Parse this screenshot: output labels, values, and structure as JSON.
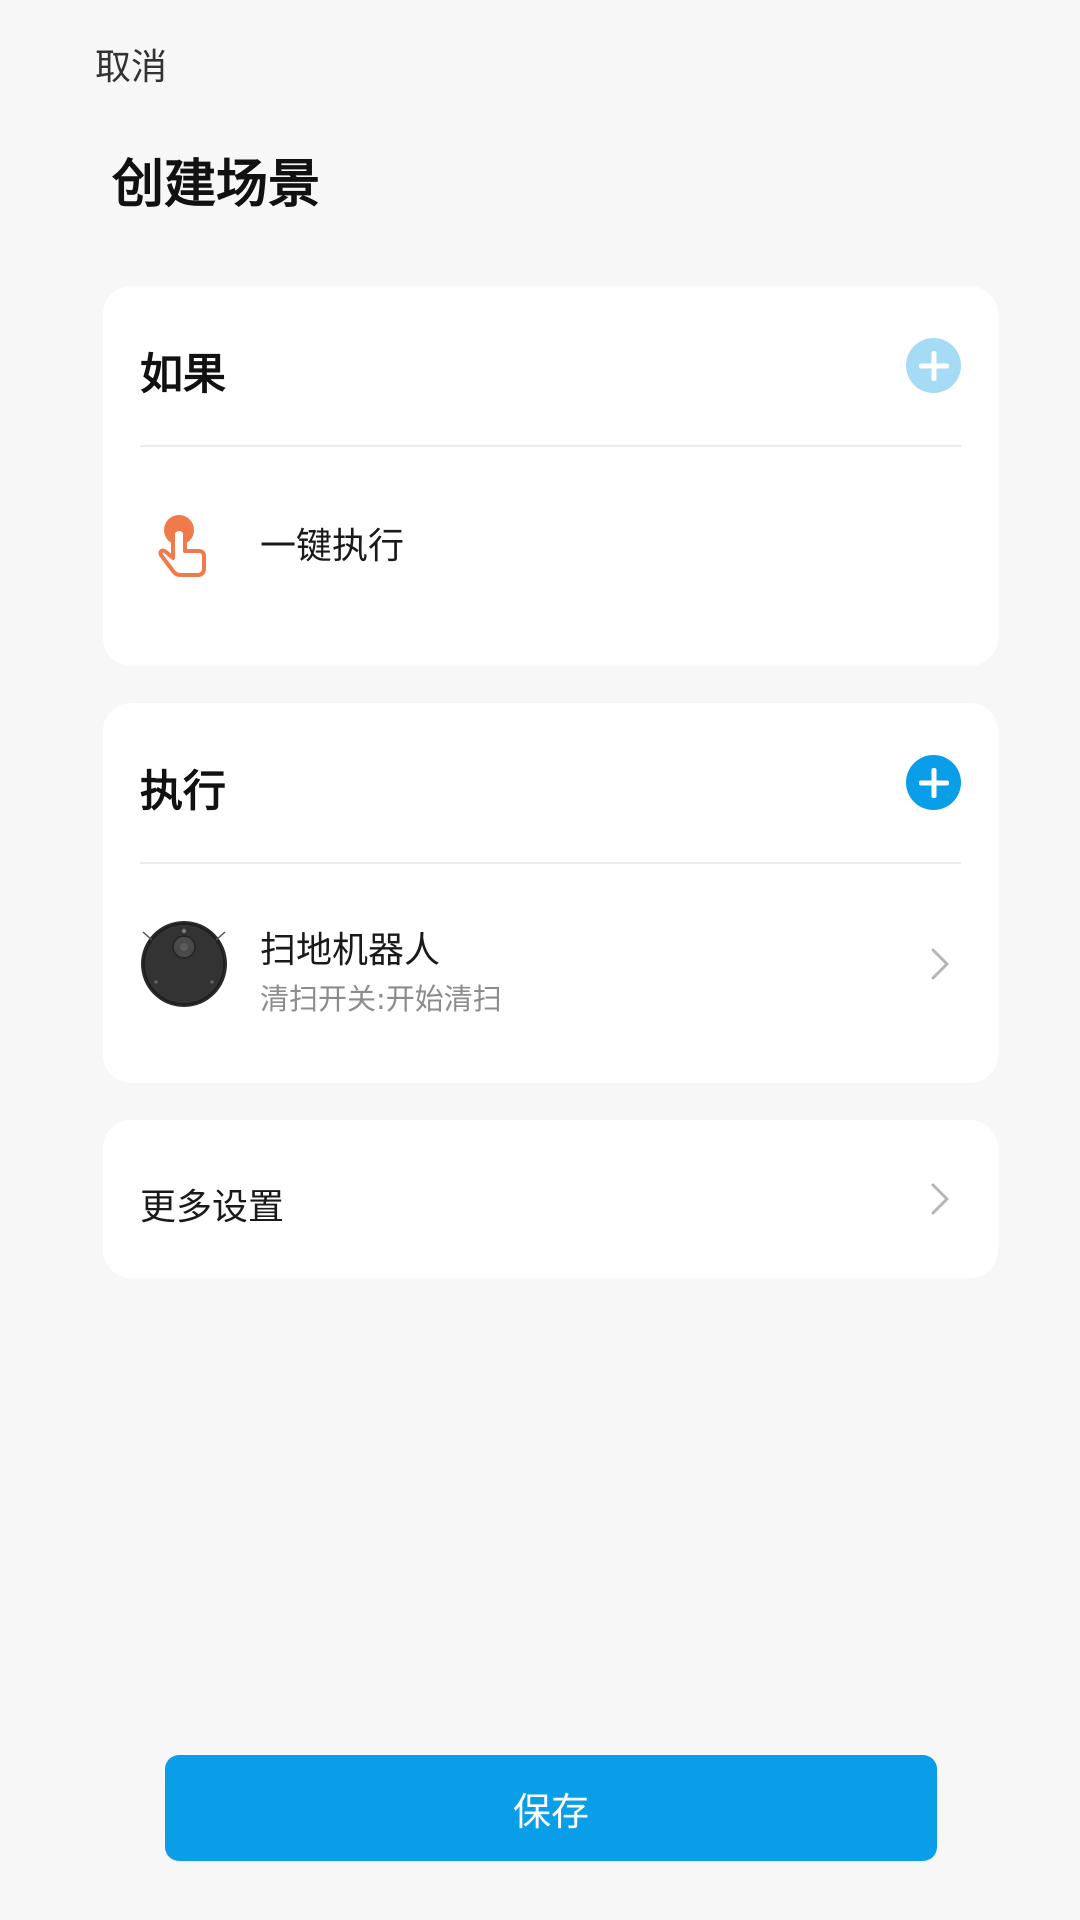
{
  "header": {
    "cancel_label": "取消",
    "title": "创建场景"
  },
  "condition_card": {
    "title": "如果",
    "add_icon": "plus-circle-icon",
    "add_color": "#a6dbf6",
    "item": {
      "icon": "hand-tap-icon",
      "label": "一键执行"
    }
  },
  "action_card": {
    "title": "执行",
    "add_icon": "plus-circle-icon",
    "add_color": "#0a9ee8",
    "item": {
      "icon": "robot-vacuum-icon",
      "title": "扫地机器人",
      "subtitle": "清扫开关:开始清扫"
    }
  },
  "more_settings": {
    "label": "更多设置"
  },
  "footer": {
    "save_label": "保存"
  },
  "colors": {
    "accent": "#0a9ee8",
    "background": "#f7f7f7",
    "card": "#ffffff",
    "hand_icon": "#f07a4c"
  }
}
